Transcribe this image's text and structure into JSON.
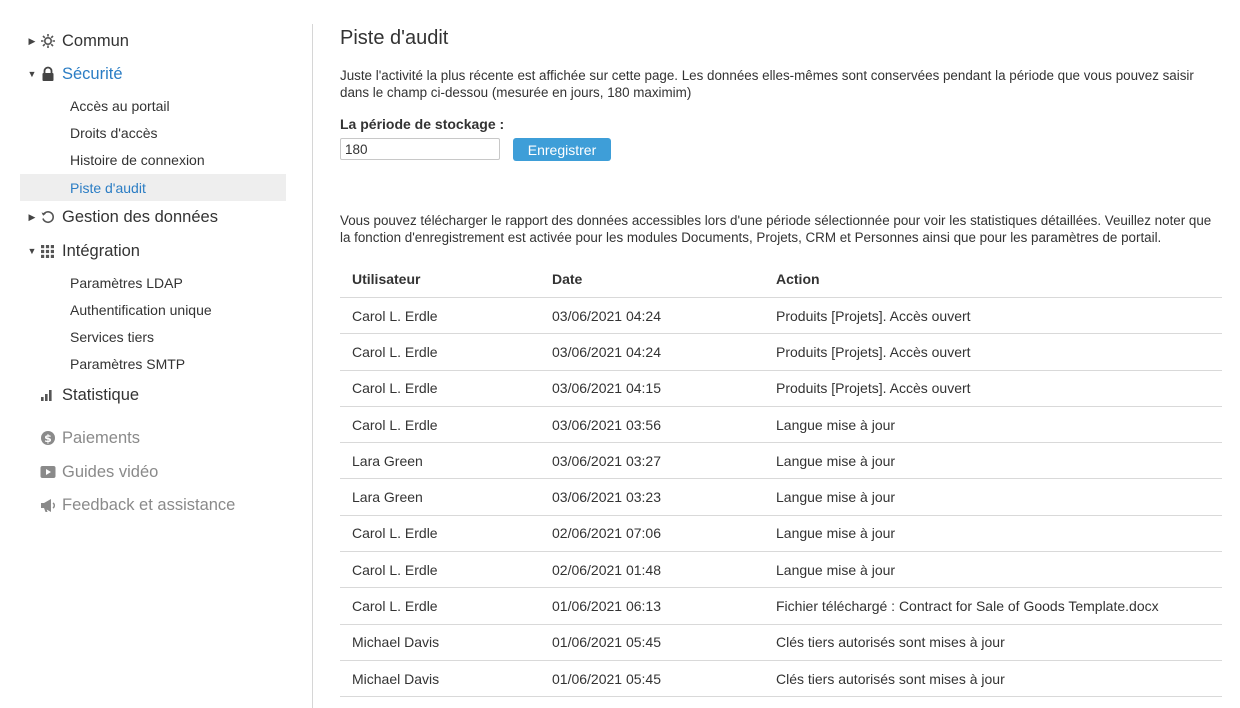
{
  "sidebar": {
    "sections": [
      {
        "label": "Commun",
        "arrow": "▶",
        "icon": "gear-icon"
      },
      {
        "label": "Sécurité",
        "arrow": "▼",
        "icon": "lock-icon"
      },
      {
        "label": "Gestion des données",
        "arrow": "▶",
        "icon": "restore-icon"
      },
      {
        "label": "Intégration",
        "arrow": "▼",
        "icon": "grid-icon"
      },
      {
        "label": "Statistique",
        "icon": "bar-chart-icon"
      },
      {
        "label": "Paiements",
        "icon": "dollar-icon"
      },
      {
        "label": "Guides vidéo",
        "icon": "video-icon"
      },
      {
        "label": "Feedback et assistance",
        "icon": "megaphone-icon"
      }
    ],
    "security_items": [
      "Accès au portail",
      "Droits d'accès",
      "Histoire de connexion",
      "Piste d'audit"
    ],
    "integration_items": [
      "Paramètres LDAP",
      "Authentification unique",
      "Services tiers",
      "Paramètres SMTP"
    ]
  },
  "main": {
    "title": "Piste d'audit",
    "intro": "Juste l'activité la plus récente est affichée sur cette page. Les données elles-mêmes sont conservées pendant la période que vous pouvez saisir dans le champ ci-dessou (mesurée en jours, 180 maximim)",
    "storage_label": "La période de stockage :",
    "storage_value": "180",
    "save_label": "Enregistrer",
    "report_text": "Vous pouvez télécharger le rapport des données accessibles lors d'une période sélectionnée pour voir les statistiques détaillées. Veuillez noter que la fonction d'enregistrement est activée pour les modules Documents, Projets, CRM et Personnes ainsi que pour les paramètres de portail."
  },
  "table": {
    "headers": {
      "user": "Utilisateur",
      "date": "Date",
      "action": "Action"
    },
    "rows": [
      {
        "user": "Carol L. Erdle",
        "date": "03/06/2021 04:24",
        "action": "Produits [Projets]. Accès ouvert"
      },
      {
        "user": "Carol L. Erdle",
        "date": "03/06/2021 04:24",
        "action": "Produits [Projets]. Accès ouvert"
      },
      {
        "user": "Carol L. Erdle",
        "date": "03/06/2021 04:15",
        "action": "Produits [Projets]. Accès ouvert"
      },
      {
        "user": "Carol L. Erdle",
        "date": "03/06/2021 03:56",
        "action": "Langue mise à jour"
      },
      {
        "user": "Lara Green",
        "date": "03/06/2021 03:27",
        "action": "Langue mise à jour"
      },
      {
        "user": "Lara Green",
        "date": "03/06/2021 03:23",
        "action": "Langue mise à jour"
      },
      {
        "user": "Carol L. Erdle",
        "date": "02/06/2021 07:06",
        "action": "Langue mise à jour"
      },
      {
        "user": "Carol L. Erdle",
        "date": "02/06/2021 01:48",
        "action": "Langue mise à jour"
      },
      {
        "user": "Carol L. Erdle",
        "date": "01/06/2021 06:13",
        "action": "Fichier téléchargé : Contract for Sale of Goods Template.docx"
      },
      {
        "user": "Michael Davis",
        "date": "01/06/2021 05:45",
        "action": "Clés tiers autorisés sont mises à jour"
      },
      {
        "user": "Michael Davis",
        "date": "01/06/2021 05:45",
        "action": "Clés tiers autorisés sont mises à jour"
      }
    ]
  },
  "colors": {
    "accent": "#2b7dc4",
    "button": "#3e9ed8",
    "selected_bg": "#eeeeee",
    "muted": "#8a8a8a"
  }
}
